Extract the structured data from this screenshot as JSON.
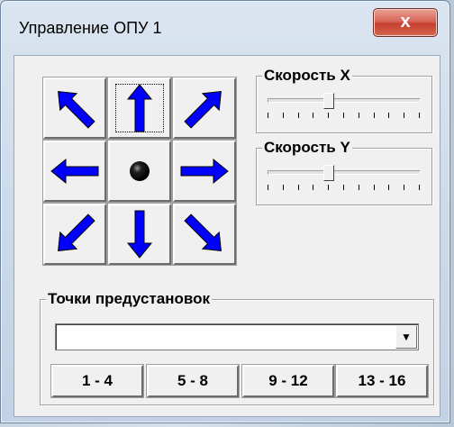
{
  "window": {
    "title": "Управление ОПУ 1",
    "close_label": "x"
  },
  "speed_x": {
    "label": "Скорость X",
    "value": 0.4
  },
  "speed_y": {
    "label": "Скорость Y",
    "value": 0.4
  },
  "presets": {
    "label": "Точки предустановок",
    "selected": "",
    "buttons": [
      "1 - 4",
      "5 - 8",
      "9 - 12",
      "13 - 16"
    ]
  },
  "colors": {
    "arrow_fill": "#0000ff",
    "arrow_stroke": "#000000"
  },
  "icons": [
    "arrow-up-left-icon",
    "arrow-up-icon",
    "arrow-up-right-icon",
    "arrow-left-icon",
    "stop-dot-icon",
    "arrow-right-icon",
    "arrow-down-left-icon",
    "arrow-down-icon",
    "arrow-down-right-icon",
    "dropdown-arrow-icon"
  ]
}
